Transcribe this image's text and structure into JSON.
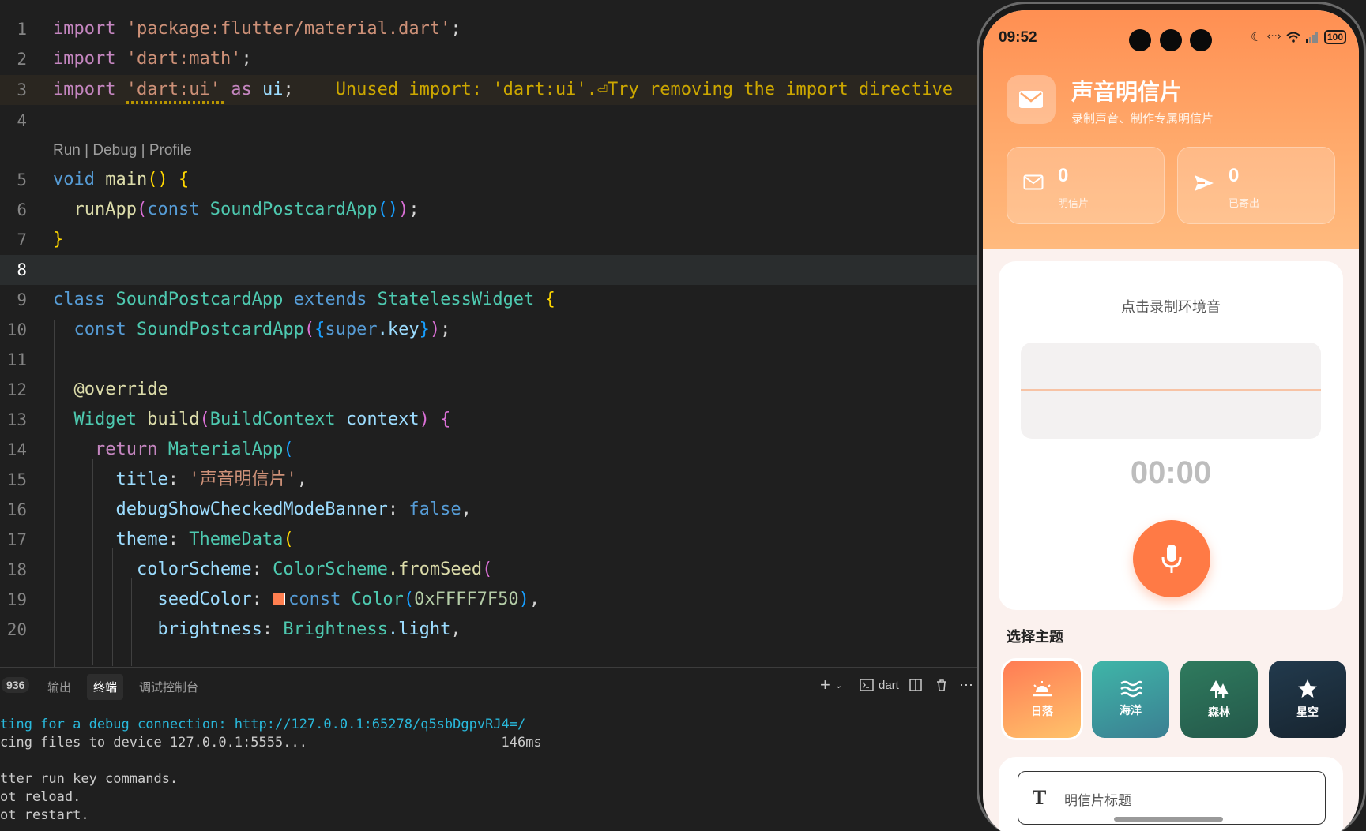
{
  "editor": {
    "codelens": "Run | Debug | Profile",
    "line_numbers": [
      "1",
      "2",
      "3",
      "4",
      "5",
      "6",
      "7",
      "8",
      "9",
      "10",
      "11",
      "12",
      "13",
      "14",
      "15",
      "16",
      "17",
      "18",
      "19",
      "20"
    ],
    "warning": "Unused import: 'dart:ui'.⏎Try removing the import directive",
    "code": {
      "l1_kw": "import",
      "l1_str": "'package:flutter/material.dart'",
      "l1_end": ";",
      "l2_kw": "import",
      "l2_str": "'dart:math'",
      "l2_end": ";",
      "l3_kw": "import",
      "l3_str": "'dart:ui'",
      "l3_as": "as",
      "l3_id": "ui",
      "l3_end": ";",
      "l5_void": "void",
      "l5_fn": "main",
      "l5_p": "()",
      "l5_b": "{",
      "l6_fn": "runApp",
      "l6_p1": "(",
      "l6_kw": "const",
      "l6_ty": "SoundPostcardApp",
      "l6_p2": "()",
      "l6_p3": ")",
      "l6_end": ";",
      "l7_b": "}",
      "l9_kw": "class",
      "l9_ty": "SoundPostcardApp",
      "l9_ext": "extends",
      "l9_ty2": "StatelessWidget",
      "l9_b": "{",
      "l10_kw": "const",
      "l10_ty": "SoundPostcardApp",
      "l10_p1": "(",
      "l10_b1": "{",
      "l10_super": "super",
      "l10_key": ".key",
      "l10_b2": "}",
      "l10_p2": ")",
      "l10_end": ";",
      "l12": "@override",
      "l13_ty": "Widget",
      "l13_fn": "build",
      "l13_p1": "(",
      "l13_ty2": "BuildContext",
      "l13_id": "context",
      "l13_p2": ")",
      "l13_b": "{",
      "l14_kw": "return",
      "l14_ty": "MaterialApp",
      "l14_p": "(",
      "l15_key": "title",
      "l15_colon": ": ",
      "l15_str": "'声音明信片'",
      "l15_end": ",",
      "l16_key": "debugShowCheckedModeBanner",
      "l16_colon": ": ",
      "l16_val": "false",
      "l16_end": ",",
      "l17_key": "theme",
      "l17_colon": ": ",
      "l17_ty": "ThemeData",
      "l17_p": "(",
      "l18_key": "colorScheme",
      "l18_colon": ": ",
      "l18_ty": "ColorScheme",
      "l18_fn": ".fromSeed",
      "l18_p": "(",
      "l19_key": "seedColor",
      "l19_colon": ": ",
      "l19_kw": "const",
      "l19_ty": "Color",
      "l19_p1": "(",
      "l19_num": "0xFFFF7F50",
      "l19_p2": ")",
      "l19_end": ",",
      "l20_key": "brightness",
      "l20_colon": ": ",
      "l20_ty": "Brightness",
      "l20_val": ".light",
      "l20_end": ","
    },
    "swatch_color": "#FF7F50"
  },
  "panel": {
    "badge": "936",
    "tabs": [
      "输出",
      "终端",
      "调试控制台"
    ],
    "active_tab": "终端",
    "shell": "dart",
    "terminal_lines": [
      "ting for a debug connection: http://127.0.0.1:65278/q5sbDgpvRJ4=/",
      "cing files to device 127.0.0.1:5555...                        146ms",
      "",
      "tter run key commands.",
      "ot reload.",
      "ot restart."
    ]
  },
  "phone": {
    "status": {
      "time": "09:52",
      "battery": "100"
    },
    "app": {
      "title": "声音明信片",
      "subtitle": "录制声音、制作专属明信片"
    },
    "stats": [
      {
        "value": "0",
        "label": "明信片",
        "icon": "mail-icon"
      },
      {
        "value": "0",
        "label": "已寄出",
        "icon": "send-icon"
      }
    ],
    "record": {
      "hint": "点击录制环境音",
      "timer": "00:00"
    },
    "theme_heading": "选择主题",
    "themes": [
      {
        "label": "日落",
        "icon": "sunset-icon",
        "color": "#FF8A5B"
      },
      {
        "label": "海洋",
        "icon": "waves-icon",
        "color": "#3FA9A2"
      },
      {
        "label": "森林",
        "icon": "forest-icon",
        "color": "#2E6B55"
      },
      {
        "label": "星空",
        "icon": "star-icon",
        "color": "#1E3142"
      }
    ],
    "title_field": {
      "placeholder": "明信片标题"
    },
    "accent": "#FF7A45"
  }
}
